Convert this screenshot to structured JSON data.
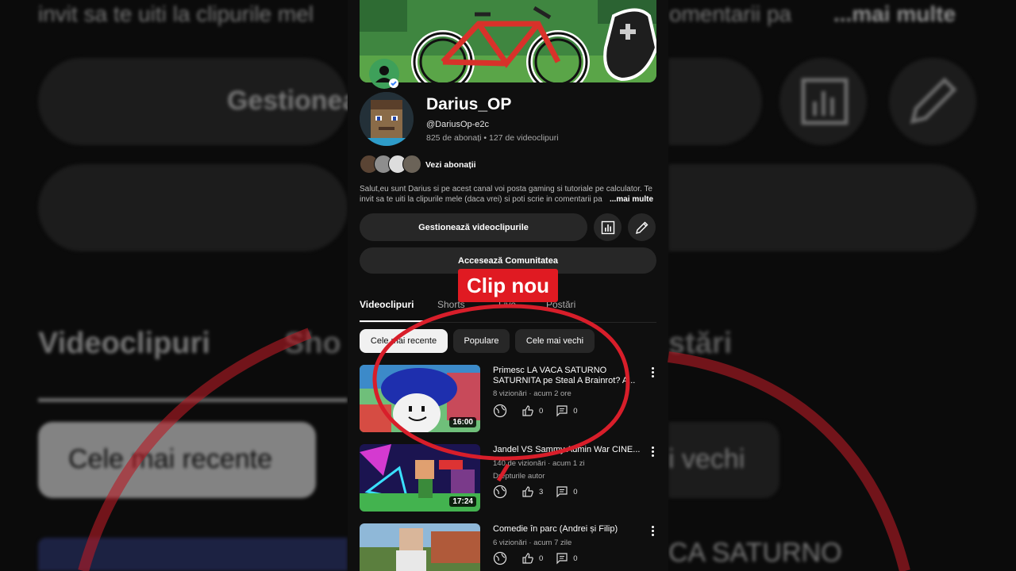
{
  "background": {
    "desc_fragment_left": "invit sa te uiti la clipurile mel",
    "desc_fragment_right": "omentarii pa",
    "more_big": "...mai multe",
    "manage_big": "Gestionea",
    "tab_videos_big": "Videoclipuri",
    "tab_shorts_big": "Sho",
    "tab_posts_big": "stări",
    "chip_recent_big": "Cele mai recente",
    "chip_oldest_big": "i vechi",
    "video_title_big": "CA SATURNO"
  },
  "channel": {
    "name": "Darius_OP",
    "handle": "@DariusOp-e2c",
    "stats": "825 de abonați • 127 de videoclipuri",
    "view_subs": "Vezi abonații",
    "description": "Salut,eu sunt Darius si pe acest canal voi posta gaming si tutoriale pe calculator. Te invit sa te uiti la clipurile mele (daca vrei) si poti scrie  in comentarii pa",
    "more": "...mai multe"
  },
  "actions": {
    "manage_videos": "Gestionează videoclipurile",
    "community": "Accesează Comunitatea",
    "analytics_icon": "bar-chart-icon",
    "edit_icon": "pencil-icon"
  },
  "tabs": [
    {
      "label": "Videoclipuri",
      "active": true
    },
    {
      "label": "Shorts",
      "active": false
    },
    {
      "label": "Live",
      "active": false
    },
    {
      "label": "Postări",
      "active": false
    }
  ],
  "chips": [
    {
      "label": "Cele mai recente",
      "selected": true
    },
    {
      "label": "Populare",
      "selected": false
    },
    {
      "label": "Cele mai vechi",
      "selected": false
    }
  ],
  "videos": [
    {
      "title": "Primesc LA VACA SATURNO SATURNITA pe Steal A Brainrot? A...",
      "meta": "8 vizionări · acum 2 ore",
      "extra": "",
      "likes": "0",
      "comments": "0",
      "duration": "16:00"
    },
    {
      "title": "Jandel VS Sammy Admin War CINE...",
      "meta": "140 de vizionări · acum 1 zi",
      "extra": "Drepturile autor",
      "likes": "3",
      "comments": "0",
      "duration": "17:24"
    },
    {
      "title": "Comedie în parc (Andrei și Filip)",
      "meta": "6 vizionări · acum 7 zile",
      "extra": "",
      "likes": "0",
      "comments": "0",
      "duration": ""
    }
  ],
  "overlay": {
    "label": "Clip nou",
    "color": "#e01a22",
    "circle_color": "#d81e2a"
  }
}
